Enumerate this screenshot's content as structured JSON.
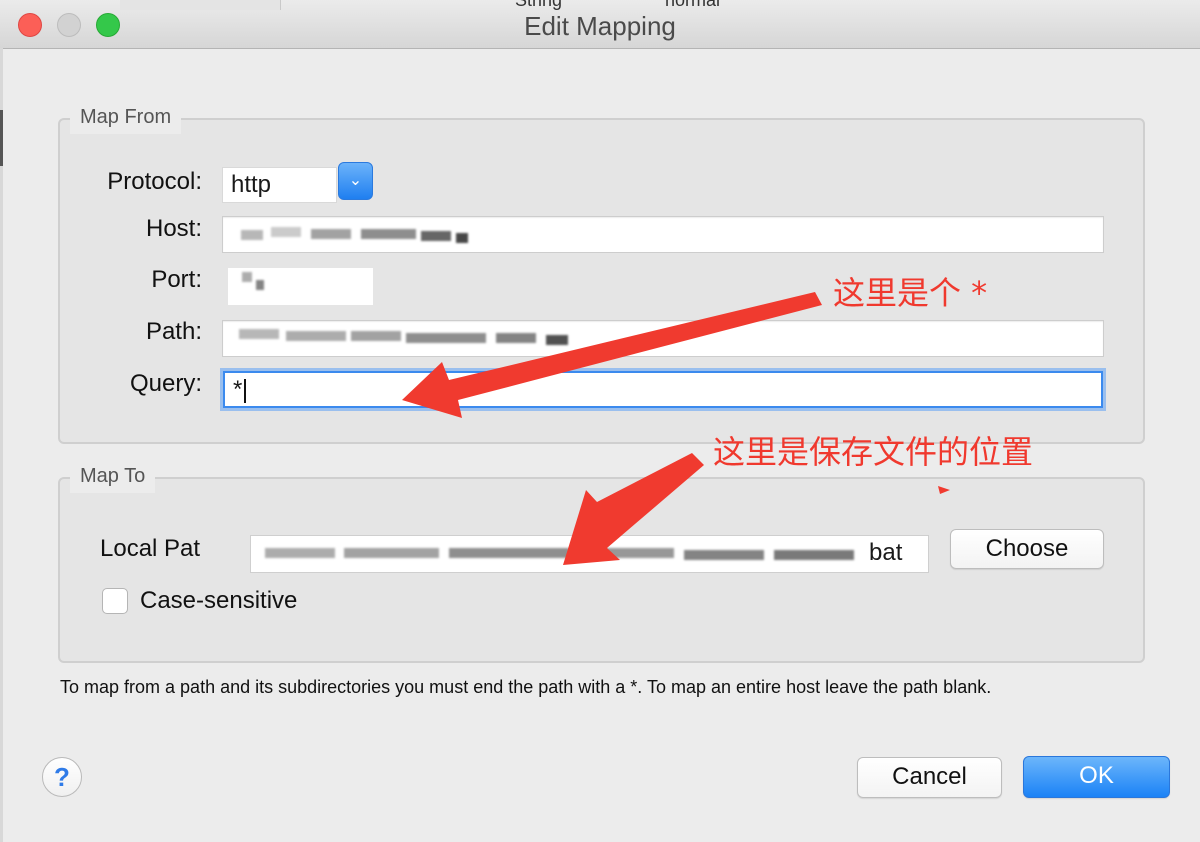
{
  "window": {
    "title": "Edit Mapping"
  },
  "background_row": {
    "col2": "",
    "col3": "String",
    "col4": "normal"
  },
  "map_from": {
    "legend": "Map From",
    "protocol": {
      "label": "Protocol:",
      "value": "http"
    },
    "host": {
      "label": "Host:"
    },
    "port": {
      "label": "Port:"
    },
    "path": {
      "label": "Path:"
    },
    "query": {
      "label": "Query:",
      "value": "*"
    }
  },
  "map_to": {
    "legend": "Map To",
    "local_path": {
      "label": "Local Pat",
      "value_visible_suffix": "bat"
    },
    "choose_label": "Choose",
    "case_sensitive": {
      "label": "Case-sensitive",
      "checked": false
    }
  },
  "hint": "To map from a path and its subdirectories you must end the path with a *. To map an entire host leave the path blank.",
  "buttons": {
    "cancel": "Cancel",
    "ok": "OK",
    "help": "?"
  },
  "annotations": {
    "query_note": "这里是个 *",
    "local_path_note": "这里是保存文件的位置"
  },
  "colors": {
    "accent": "#1b82f6",
    "annotation": "#f0392e",
    "close": "#fc5f57",
    "maximize": "#34c84a"
  },
  "icons": {
    "select_arrow": "chevron-down-icon",
    "help": "help-icon"
  }
}
